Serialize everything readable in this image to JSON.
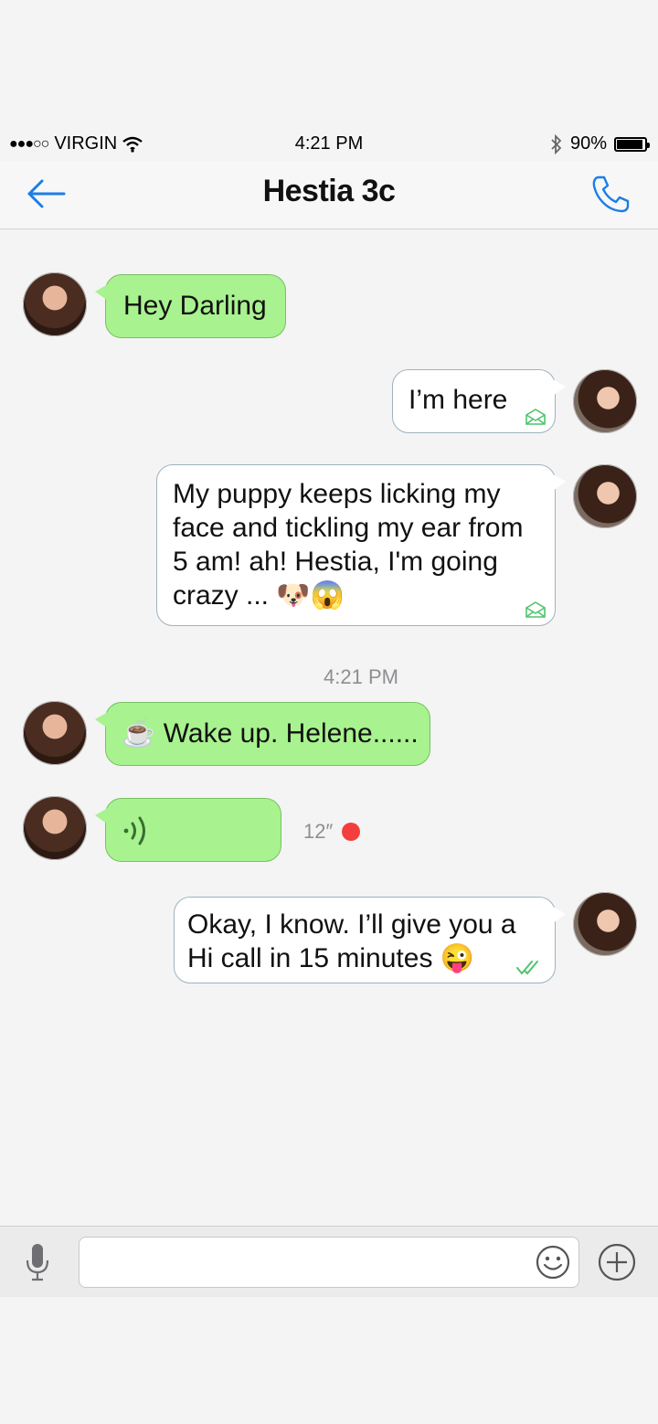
{
  "status_bar": {
    "signal_dots": "●●●○○",
    "carrier": "VIRGIN",
    "time": "4:21 PM",
    "battery": "90%",
    "battery_level": 0.9,
    "icons": [
      "wifi-icon",
      "bluetooth-icon",
      "battery-icon"
    ]
  },
  "header": {
    "title": "Hestia 3c",
    "accent_color": "#1a7ee6"
  },
  "messages": [
    {
      "direction": "in",
      "text": "Hey Darling"
    },
    {
      "direction": "out",
      "text": "I’m here",
      "status": "delivered"
    },
    {
      "direction": "out",
      "text": "My puppy keeps licking my face and tickling my ear from 5 am! ah!  Hestia, I'm going crazy ... 🐶😱",
      "status": "delivered"
    },
    {
      "direction": "in",
      "text": "☕ Wake up. Helene......"
    },
    {
      "direction": "in",
      "type": "voice",
      "duration": "12″"
    },
    {
      "direction": "out",
      "text": "Okay, I know. I’ll give you a Hi call in 15 minutes 😜",
      "status": "read"
    }
  ],
  "timestamp": "4:21 PM",
  "colors": {
    "incoming_bubble": "#a8f28f",
    "outgoing_bubble": "#ffffff",
    "unread_dot": "#f43e3e"
  }
}
